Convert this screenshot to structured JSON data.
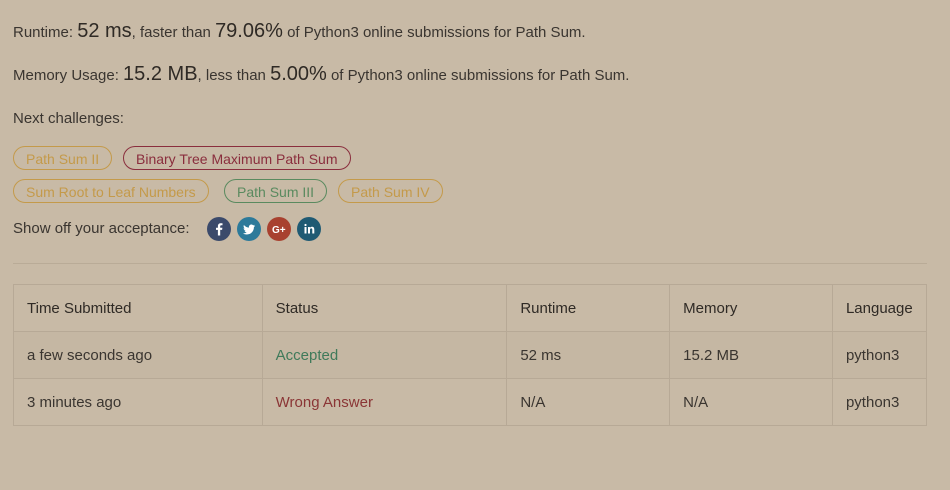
{
  "runtime_line": {
    "label": "Runtime:",
    "value": "52 ms",
    "mid": ", faster than",
    "percent": "79.06%",
    "suffix": "of Python3 online submissions for Path Sum."
  },
  "memory_line": {
    "label": "Memory Usage:",
    "value": "15.2 MB",
    "mid": ", less than",
    "percent": "5.00%",
    "suffix": "of Python3 online submissions for Path Sum."
  },
  "next_challenges": {
    "label": "Next challenges:",
    "items": [
      {
        "label": "Path Sum II",
        "difficulty_color": "#c49a4a"
      },
      {
        "label": "Binary Tree Maximum Path Sum",
        "difficulty_color": "#8a2e3d"
      },
      {
        "label": "Sum Root to Leaf Numbers",
        "difficulty_color": "#c49a4a"
      },
      {
        "label": "Path Sum III",
        "difficulty_color": "#5a8a5f"
      },
      {
        "label": "Path Sum IV",
        "difficulty_color": "#c49a4a"
      }
    ]
  },
  "share": {
    "label": "Show off your acceptance:",
    "icons": [
      {
        "name": "facebook-icon",
        "glyph": "f",
        "color": "#3b4a6b"
      },
      {
        "name": "twitter-icon",
        "glyph": "t",
        "color": "#2d7a9a"
      },
      {
        "name": "google-plus-icon",
        "glyph": "G+",
        "color": "#a8412f"
      },
      {
        "name": "linkedin-icon",
        "glyph": "in",
        "color": "#1f5a73"
      }
    ]
  },
  "table": {
    "headers": [
      "Time Submitted",
      "Status",
      "Runtime",
      "Memory",
      "Language"
    ],
    "rows": [
      {
        "time": "a few seconds ago",
        "status": "Accepted",
        "runtime": "52 ms",
        "memory": "15.2 MB",
        "language": "python3"
      },
      {
        "time": "3 minutes ago",
        "status": "Wrong Answer",
        "runtime": "N/A",
        "memory": "N/A",
        "language": "python3"
      }
    ]
  }
}
